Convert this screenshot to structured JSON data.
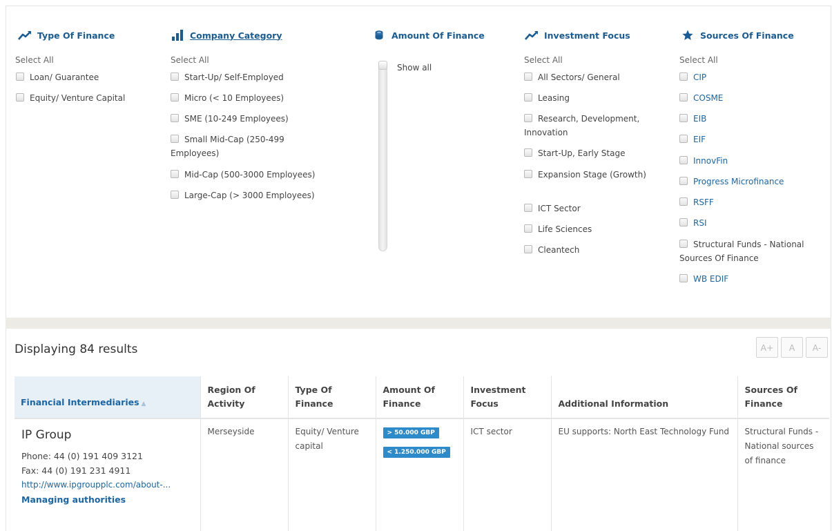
{
  "filters": {
    "type_of_finance": {
      "title": "Type Of Finance",
      "select_all": "Select All",
      "options": [
        "Loan/ Guarantee",
        "Equity/ Venture Capital"
      ]
    },
    "company_category": {
      "title": "Company Category",
      "select_all": "Select All",
      "options": [
        "Start-Up/ Self-Employed",
        "Micro (< 10 Employees)",
        "SME (10-249 Employees)",
        "Small Mid-Cap (250-499 Employees)",
        "Mid-Cap (500-3000 Employees)",
        "Large-Cap (> 3000 Employees)"
      ]
    },
    "amount_of_finance": {
      "title": "Amount Of Finance",
      "show_all": "Show all"
    },
    "investment_focus": {
      "title": "Investment Focus",
      "select_all": "Select All",
      "options": [
        "All Sectors/ General",
        "Leasing",
        "Research, Development, Innovation",
        "Start-Up, Early Stage",
        "Expansion Stage (Growth)",
        "ICT Sector",
        "Life Sciences",
        "Cleantech"
      ]
    },
    "sources_of_finance": {
      "title": "Sources Of Finance",
      "select_all": "Select All",
      "options": [
        "CIP",
        "COSME",
        "EIB",
        "EIF",
        "InnovFin",
        "Progress Microfinance",
        "RSFF",
        "RSI",
        "Structural Funds - National Sources Of Finance",
        "WB EDIF"
      ]
    }
  },
  "results": {
    "count_label": "Displaying 84 results",
    "zoom": {
      "increase": "A+",
      "reset": "A",
      "decrease": "A-"
    },
    "columns": [
      "Financial Intermediaries",
      "Region Of Activity",
      "Type Of Finance",
      "Amount Of Finance",
      "Investment Focus",
      "Additional Information",
      "Sources Of Finance"
    ],
    "rows": [
      {
        "name": "IP Group",
        "phone": "Phone: 44 (0) 191 409 3121",
        "fax": "Fax: 44 (0) 191 231 4911",
        "url": "http://www.ipgroupplc.com/about-...",
        "managing": "Managing authorities",
        "region": "Merseyside",
        "type": "Equity/ Venture capital",
        "amount_min": "> 50.000 GBP",
        "amount_max": "< 1.250.000 GBP",
        "focus": "ICT sector",
        "info": "EU supports: North East Technology Fund",
        "sources": "Structural Funds - National sources of finance"
      }
    ]
  },
  "colors": {
    "accent": "#1a5c95",
    "link": "#1a66a8",
    "badge": "#2e8bc9",
    "header_highlight": "#e8f0f7",
    "band": "#ecebe6"
  },
  "icons": {
    "type_of_finance": "trend-line-icon",
    "company_category": "bar-chart-icon",
    "amount_of_finance": "coin-stack-icon",
    "investment_focus": "trend-line-icon",
    "sources_of_finance": "star-icon"
  }
}
